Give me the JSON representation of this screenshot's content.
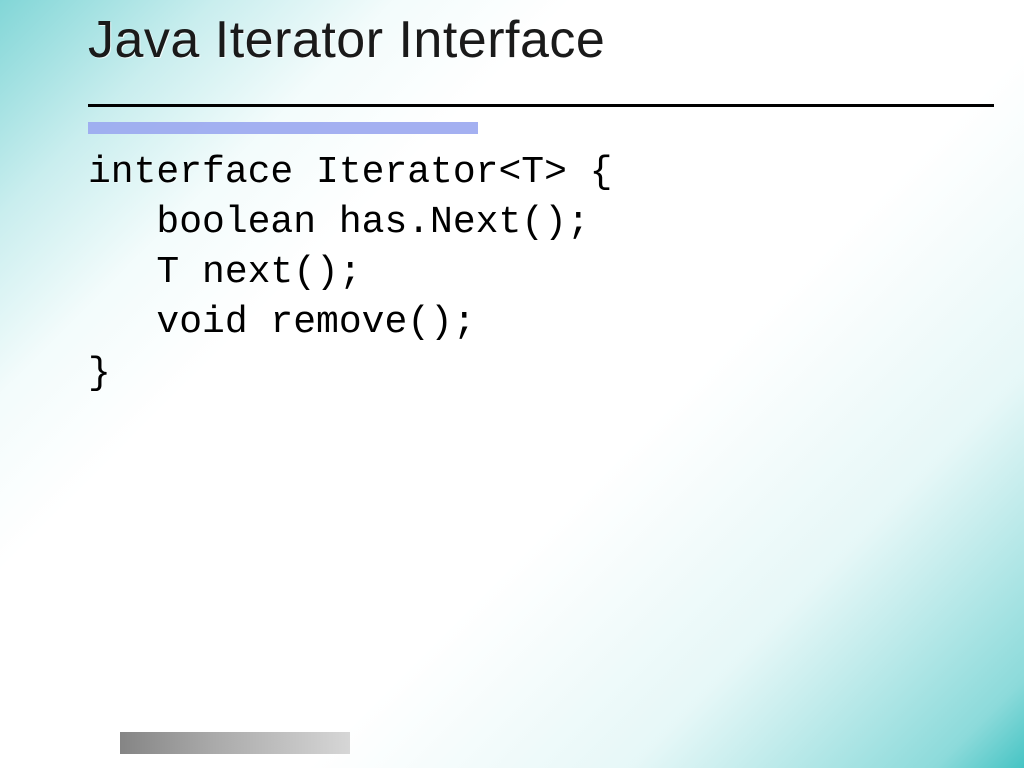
{
  "slide": {
    "title": "Java Iterator Interface",
    "code": {
      "l1": "interface Iterator<T> {",
      "l2": "   boolean has.Next();",
      "l3": "   T next();",
      "l4": "   void remove();",
      "l5": "}"
    }
  }
}
